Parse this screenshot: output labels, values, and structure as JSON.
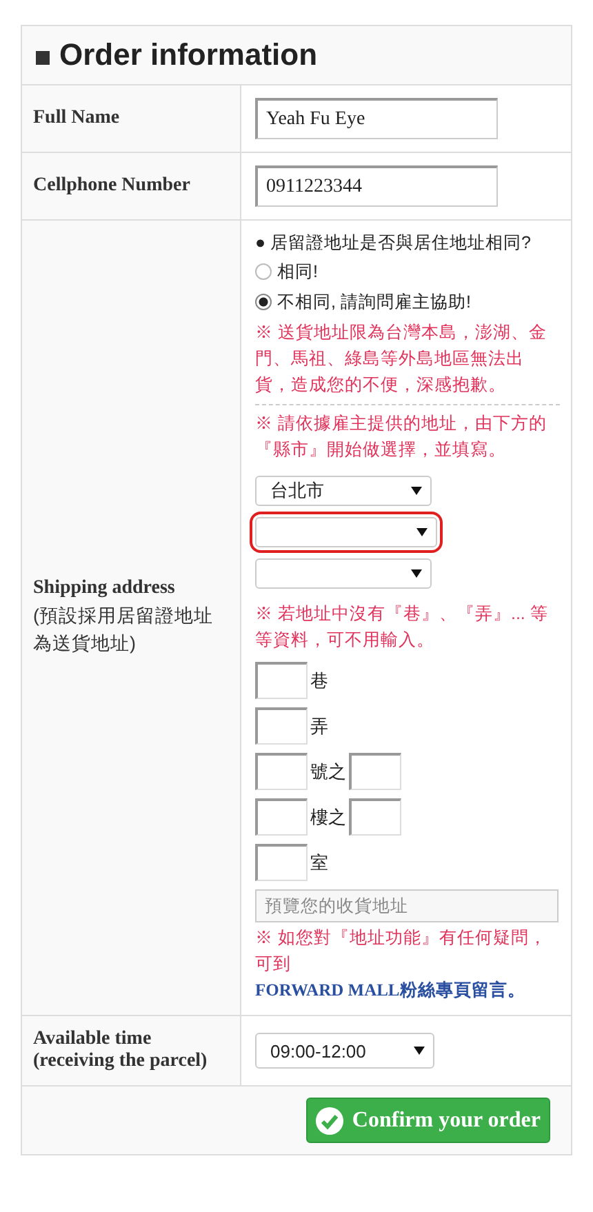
{
  "title": "Order information",
  "full_name": {
    "label": "Full Name",
    "value": "Yeah Fu Eye"
  },
  "cellphone": {
    "label": "Cellphone Number",
    "value": "0911223344"
  },
  "shipping": {
    "label": "Shipping address",
    "sublabel": "(預設採用居留證地址為送貨地址)",
    "question": "● 居留證地址是否與居住地址相同?",
    "options": [
      {
        "label": "相同!",
        "selected": false
      },
      {
        "label": "不相同, 請詢問雇主協助!",
        "selected": true
      }
    ],
    "note_1": "※ 送貨地址限為台灣本島，澎湖、金門、馬祖、綠島等外島地區無法出貨，造成您的不便，深感抱歉。",
    "note_2": "※ 請依據雇主提供的地址，由下方的『縣市』開始做選擇，並填寫。",
    "selects": [
      {
        "value": "台北市",
        "highlighted": false
      },
      {
        "highlighted": true
      },
      {
        "highlighted": false
      }
    ],
    "note_3": "※ 若地址中沒有『巷』、『弄』... 等等資料，可不用輸入。",
    "address_parts": [
      {
        "suffix": "巷",
        "kind": "single"
      },
      {
        "suffix": "弄",
        "kind": "single"
      },
      {
        "suffix": "號之",
        "kind": "pair"
      },
      {
        "suffix": "樓之",
        "kind": "pair"
      },
      {
        "suffix": "室",
        "kind": "single"
      }
    ],
    "preview": {
      "placeholder": "預覽您的收貨地址"
    },
    "note_4": "※ 如您對『地址功能』有任何疑問，可到",
    "note_4_link": "FORWARD MALL粉絲專頁留言。"
  },
  "time": {
    "label": "Available time",
    "sublabel": "(receiving the parcel)",
    "value": "09:00-12:00"
  },
  "confirm": "Confirm your order"
}
